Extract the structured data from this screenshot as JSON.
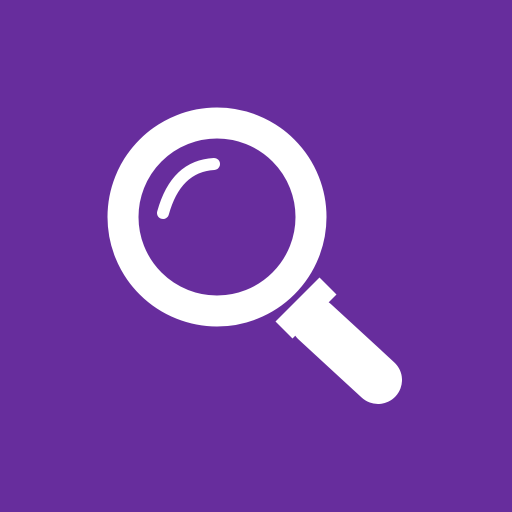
{
  "app_icon": {
    "icon": "search-icon",
    "colors": {
      "background": "#672d9d",
      "foreground": "#ffffff"
    }
  }
}
